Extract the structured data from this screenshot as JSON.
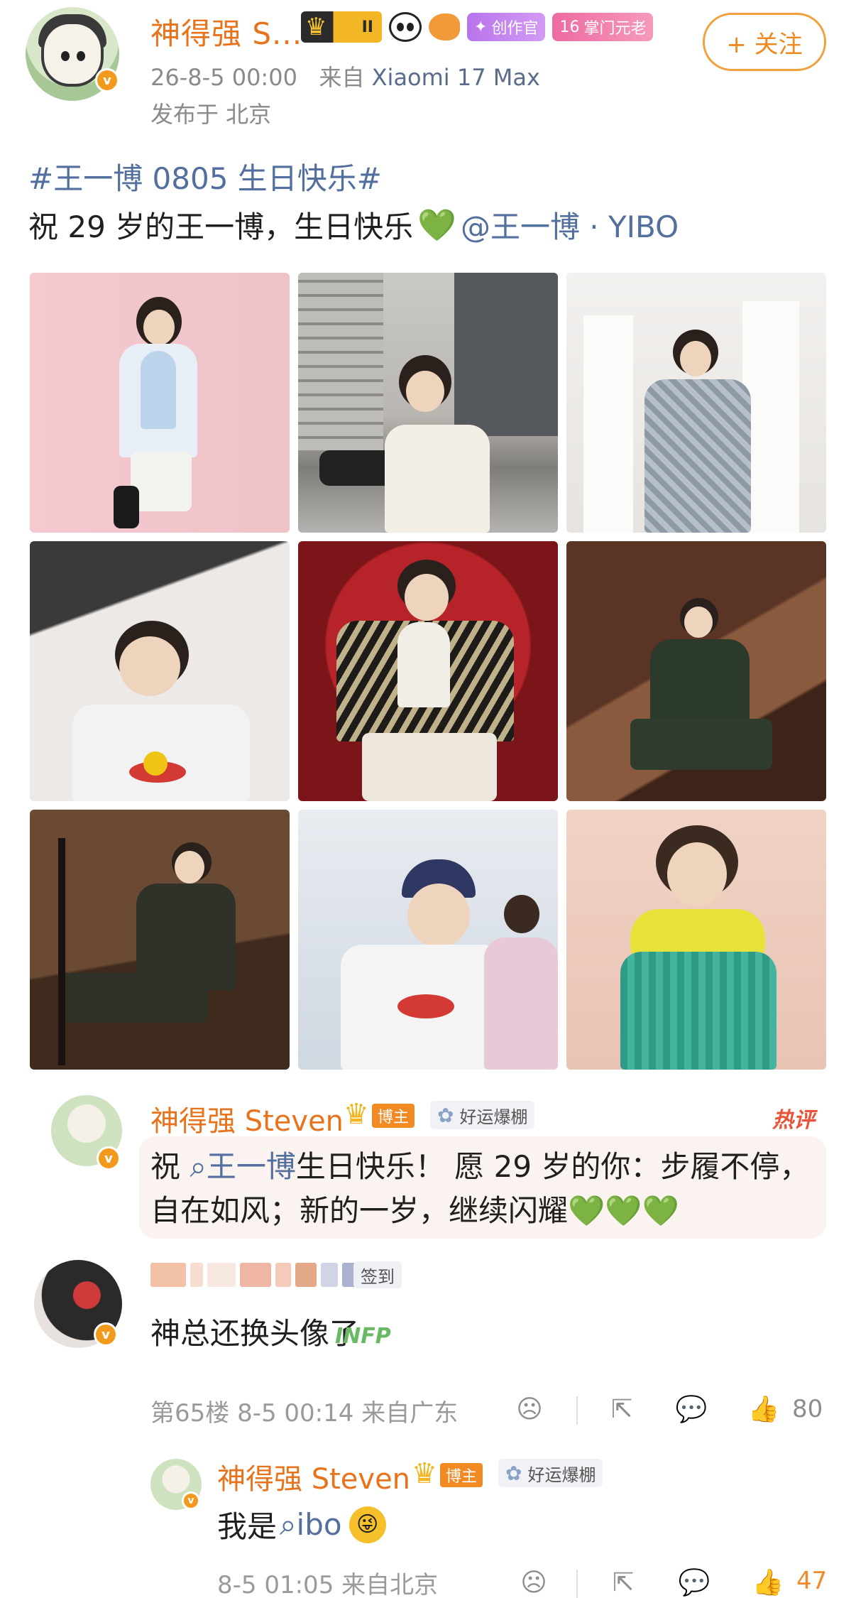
{
  "post": {
    "author": "神得强 S...",
    "badges": {
      "level_roman": "II",
      "creator": "创作官",
      "elder_level": "16",
      "elder": "掌门元老"
    },
    "follow_label": "+ 关注",
    "time": "26-8-5 00:00",
    "device_prefix": "来自",
    "device": "Xiaomi 17 Max",
    "location": "发布于 北京",
    "topic": "#王一博 0805 生日快乐#",
    "text_before": "祝 29 岁的王一博，生日快乐",
    "mention": "@王一博 · YIBO",
    "heart_icon": "green-heart"
  },
  "hot_comment": {
    "name": "神得强 Steven",
    "role": "博主",
    "lucky": "好运爆棚",
    "tag": "热评",
    "text_1": "祝",
    "link": "王一博",
    "text_2": "生日快乐！ 愿 29 岁的你：步履不停，自在如风；新的一岁，继续闪耀",
    "hearts": "💚💚💚"
  },
  "reply": {
    "signin": "签到",
    "text": "神总还换头像了",
    "sticker": "INFP",
    "floor": "第65楼",
    "time": "8-5 00:14",
    "location": "来自广东",
    "likes": "80"
  },
  "sub_reply": {
    "name": "神得强 Steven",
    "role": "博主",
    "lucky": "好运爆棚",
    "text_1": "我是",
    "link": "ibo",
    "emoji": "😜",
    "time": "8-5 01:05",
    "location": "来自北京",
    "likes": "47"
  },
  "colors": {
    "username": "#e8731d",
    "link": "#536f9e",
    "follow": "#ef8a1f",
    "heart": "#27b835"
  }
}
